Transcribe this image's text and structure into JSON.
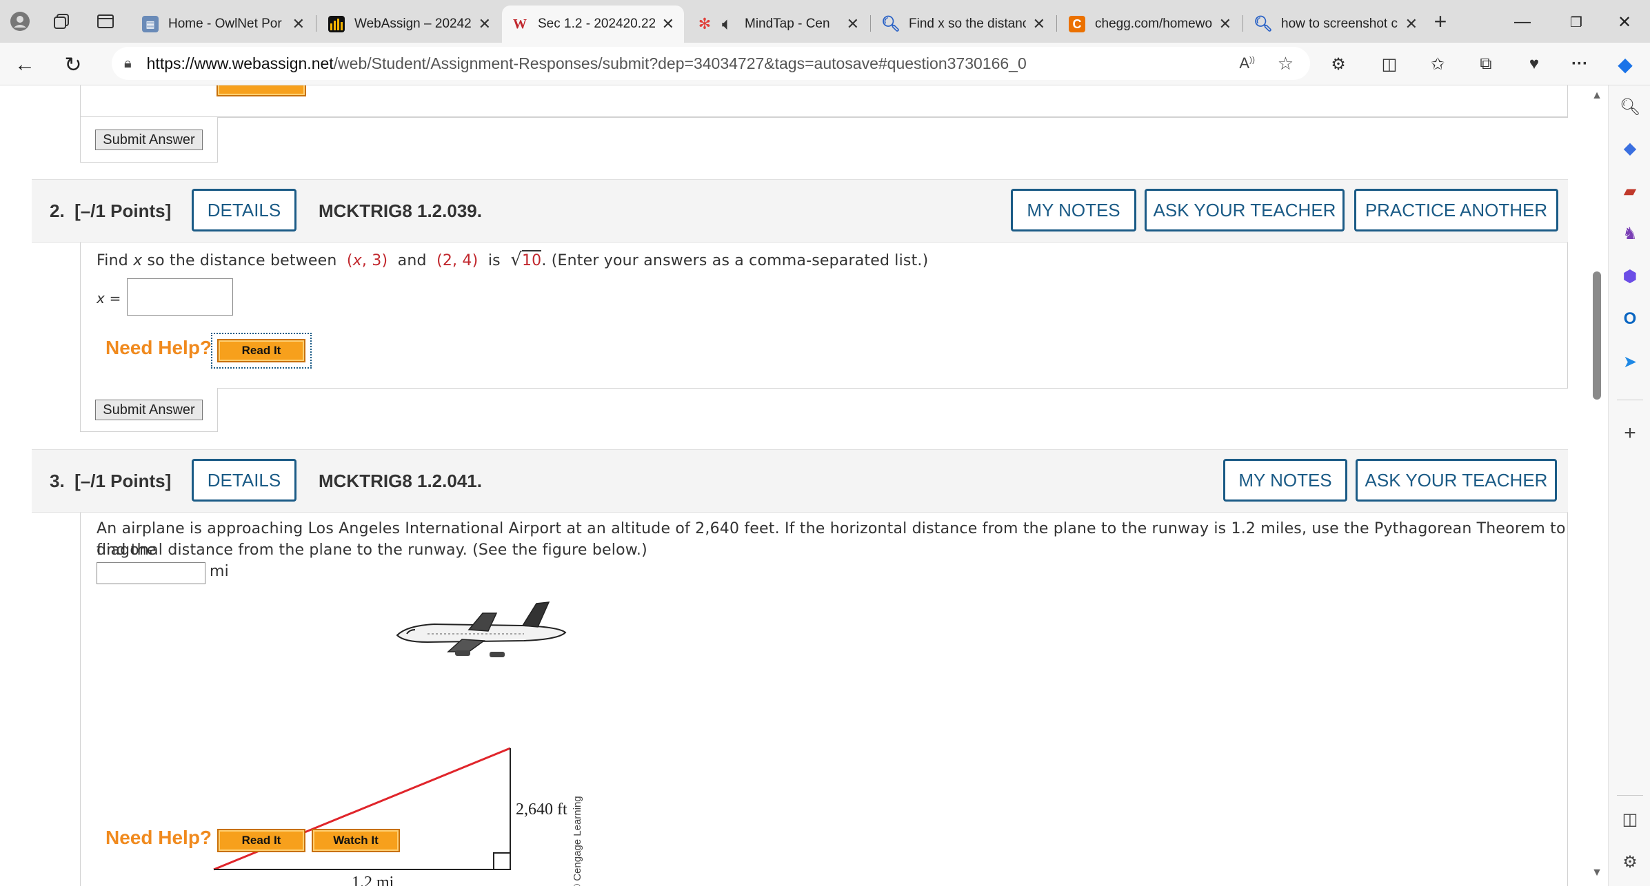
{
  "browser": {
    "tabs": [
      {
        "title": "Home - OwlNet Por",
        "favicon": "owlnet-icon",
        "active": false
      },
      {
        "title": "WebAssign – 20242",
        "favicon": "webassign-icon",
        "active": false
      },
      {
        "title": "Sec 1.2 - 202420.22",
        "favicon": "webassign-wa-icon",
        "active": true
      },
      {
        "title": "MindTap - Cen",
        "favicon": "mindtap-icon",
        "active": false
      },
      {
        "title": "Find x so the distanc",
        "favicon": "search-icon",
        "active": false
      },
      {
        "title": "chegg.com/homewo",
        "favicon": "chegg-icon",
        "active": false
      },
      {
        "title": "how to screenshot c",
        "favicon": "search-icon",
        "active": false
      }
    ],
    "url_domain": "https://www.webassign.net",
    "url_path": "/web/Student/Assignment-Responses/submit?dep=34034727&tags=autosave#question3730166_0"
  },
  "prev_question": {
    "submit_label": "Submit Answer"
  },
  "question2": {
    "number": "2.",
    "points": "[–/1 Points]",
    "details_label": "DETAILS",
    "code": "MCKTRIG8 1.2.039.",
    "my_notes_label": "MY NOTES",
    "ask_teacher_label": "ASK YOUR TEACHER",
    "practice_label": "PRACTICE ANOTHER",
    "text_prefix": "Find",
    "text_var": "x",
    "text_mid1": "so the distance between",
    "point1_open": "(",
    "point1_x": "x",
    "point1_y": ", 3)",
    "text_and": "and",
    "point2": "(2, 4)",
    "text_is": "is",
    "sqrt_value": "10",
    "text_suffix": ". (Enter your answers as a comma-separated list.)",
    "answer_label": "x =",
    "answer_value": "",
    "need_help": "Need Help?",
    "read_it": "Read It",
    "submit_label": "Submit Answer"
  },
  "question3": {
    "number": "3.",
    "points": "[–/1 Points]",
    "details_label": "DETAILS",
    "code": "MCKTRIG8 1.2.041.",
    "my_notes_label": "MY NOTES",
    "ask_teacher_label": "ASK YOUR TEACHER",
    "text_line1": "An airplane is approaching Los Angeles International Airport at an altitude of 2,640 feet. If the horizontal distance from the plane to the runway is 1.2 miles, use the Pythagorean Theorem to find the",
    "text_line2": "diagonal distance from the plane to the runway. (See the figure below.)",
    "answer_value": "",
    "unit": "mi",
    "figure": {
      "height_label": "2,640 ft",
      "base_label": "1.2 mi",
      "credit": "© Cengage Learning"
    },
    "need_help": "Need Help?",
    "read_it": "Read It",
    "watch_it": "Watch It"
  },
  "colors": {
    "accent": "#1b5b86",
    "need_help": "#f08a1e",
    "hypotenuse": "#e0252b",
    "help_button": "#f7a01c"
  }
}
